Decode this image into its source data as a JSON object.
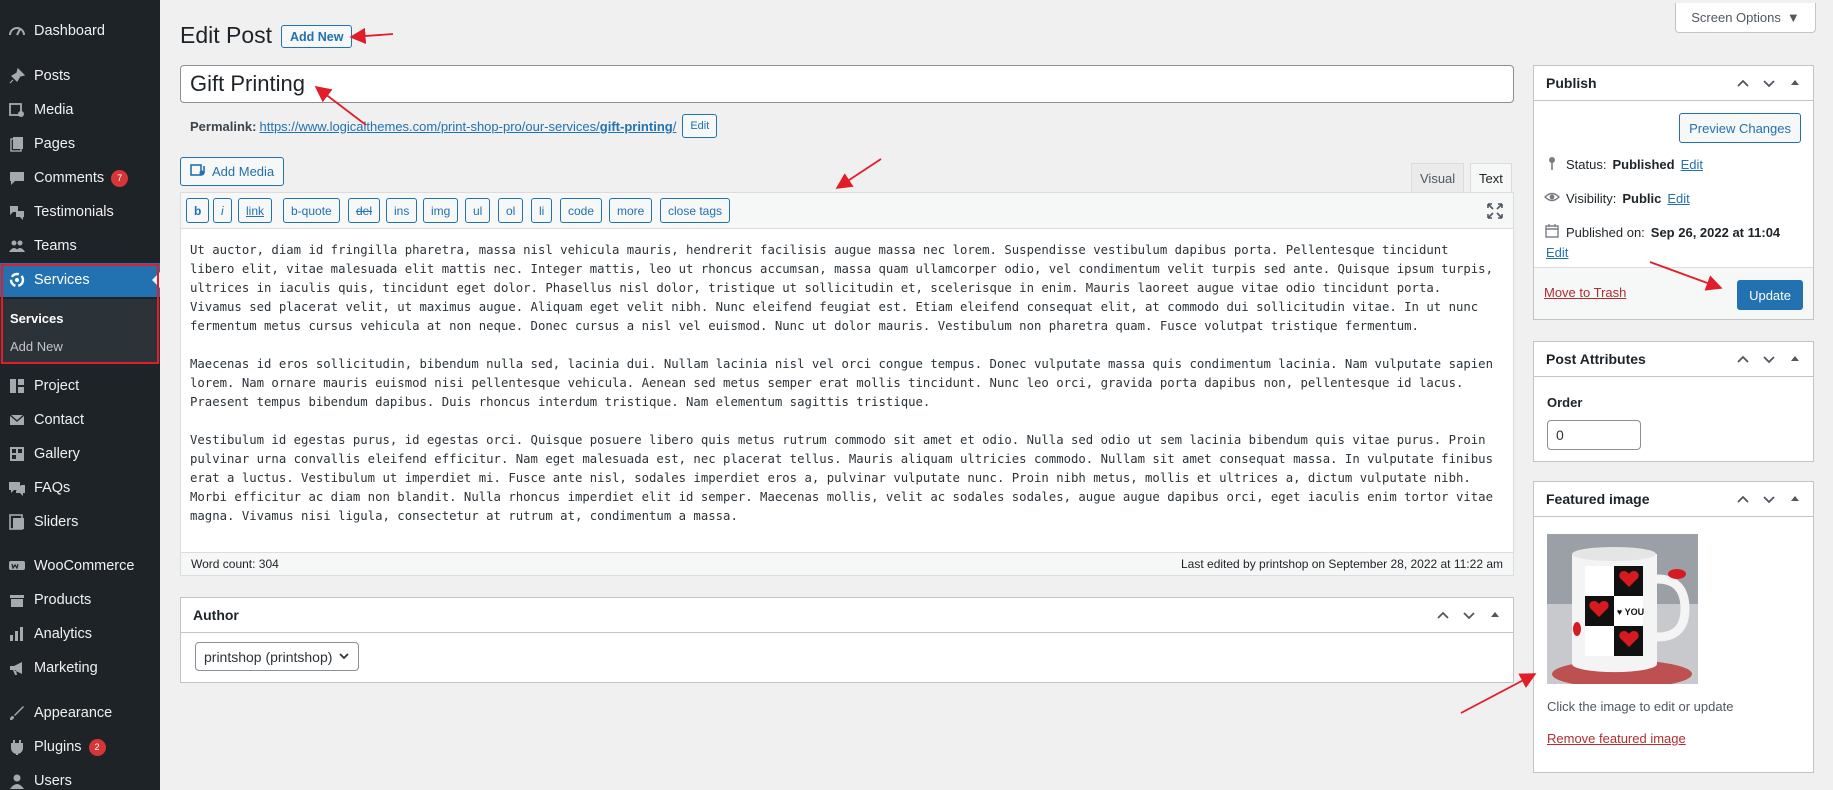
{
  "colors": {
    "sidebar_bg": "#1d2327",
    "accent": "#2271b1",
    "danger": "#b32d2e",
    "badge": "#d63638",
    "annotation": "#e11d2a"
  },
  "sidebar": {
    "items": [
      {
        "label": "Dashboard",
        "icon": "dashboard-icon"
      },
      {
        "label": "Posts",
        "icon": "pushpin-icon"
      },
      {
        "label": "Media",
        "icon": "media-icon"
      },
      {
        "label": "Pages",
        "icon": "pages-icon"
      },
      {
        "label": "Comments",
        "icon": "comments-icon",
        "badge": "7"
      },
      {
        "label": "Testimonials",
        "icon": "testimonials-icon"
      },
      {
        "label": "Teams",
        "icon": "teams-icon"
      },
      {
        "label": "Services",
        "icon": "services-icon"
      },
      {
        "label": "Project",
        "icon": "project-icon"
      },
      {
        "label": "Contact",
        "icon": "mail-icon"
      },
      {
        "label": "Gallery",
        "icon": "gallery-icon"
      },
      {
        "label": "FAQs",
        "icon": "faq-icon"
      },
      {
        "label": "Sliders",
        "icon": "sliders-icon"
      },
      {
        "label": "WooCommerce",
        "icon": "woocommerce-icon"
      },
      {
        "label": "Products",
        "icon": "products-icon"
      },
      {
        "label": "Analytics",
        "icon": "analytics-icon"
      },
      {
        "label": "Marketing",
        "icon": "marketing-icon"
      },
      {
        "label": "Appearance",
        "icon": "appearance-icon"
      },
      {
        "label": "Plugins",
        "icon": "plugins-icon",
        "badge": "2"
      },
      {
        "label": "Users",
        "icon": "users-icon"
      }
    ],
    "submenu": {
      "services": "Services",
      "add_new": "Add New"
    }
  },
  "header": {
    "screen_options": "Screen Options",
    "title": "Edit Post",
    "add_new": "Add New"
  },
  "post": {
    "title": "Gift Printing",
    "permalink_label": "Permalink:",
    "permalink_base": "https://www.logicalthemes.com/print-shop-pro/our-services/",
    "permalink_slug": "gift-printing",
    "permalink_trailing": "/",
    "permalink_edit": "Edit"
  },
  "editor": {
    "add_media": "Add Media",
    "tab_visual": "Visual",
    "tab_text": "Text",
    "quicktags": [
      "b",
      "i",
      "link",
      "b-quote",
      "del",
      "ins",
      "img",
      "ul",
      "ol",
      "li",
      "code",
      "more",
      "close tags"
    ],
    "paragraphs": [
      "Ut auctor, diam id fringilla pharetra, massa nisl vehicula mauris, hendrerit facilisis augue massa nec lorem. Suspendisse vestibulum dapibus porta. Pellentesque tincidunt libero elit, vitae malesuada elit mattis nec. Integer mattis, leo ut rhoncus accumsan, massa quam ullamcorper odio, vel condimentum velit turpis sed ante. Quisque ipsum turpis, ultrices in iaculis quis, tincidunt eget dolor. Phasellus nisl dolor, tristique ut sollicitudin et, scelerisque in enim. Mauris laoreet augue vitae odio tincidunt porta. Vivamus sed placerat velit, ut maximus augue. Aliquam eget velit nibh. Nunc eleifend feugiat est. Etiam eleifend consequat elit, at commodo dui sollicitudin vitae. In ut nunc fermentum metus cursus vehicula at non neque. Donec cursus a nisl vel euismod. Nunc ut dolor mauris. Vestibulum non pharetra quam. Fusce volutpat tristique fermentum.",
      "Maecenas id eros sollicitudin, bibendum nulla sed, lacinia dui. Nullam lacinia nisl vel orci congue tempus. Donec vulputate massa quis condimentum lacinia. Nam vulputate sapien lorem. Nam ornare mauris euismod nisi pellentesque vehicula. Aenean sed metus semper erat mollis tincidunt. Nunc leo orci, gravida porta dapibus non, pellentesque id lacus. Praesent tempus bibendum dapibus. Duis rhoncus interdum tristique. Nam elementum sagittis tristique.",
      "Vestibulum id egestas purus, id egestas orci. Quisque posuere libero quis metus rutrum commodo sit amet et odio. Nulla sed odio ut sem lacinia bibendum quis vitae purus. Proin pulvinar urna convallis eleifend efficitur. Nam eget malesuada est, nec placerat tellus. Mauris aliquam ultricies commodo. Nullam sit amet consequat massa. In vulputate finibus erat a luctus. Vestibulum ut imperdiet mi. Fusce ante nisl, sodales imperdiet eros a, pulvinar vulputate nunc. Proin nibh metus, mollis et ultrices a, dictum vulputate nibh. Morbi efficitur ac diam non blandit. Nulla rhoncus imperdiet elit id semper. Maecenas mollis, velit ac sodales sodales, augue augue dapibus orci, eget iaculis enim tortor vitae magna. Vivamus nisi ligula, consectetur at rutrum at, condimentum a massa."
    ],
    "word_count": "Word count: 304",
    "last_edited": "Last edited by printshop on September 28, 2022 at 11:22 am"
  },
  "author": {
    "title": "Author",
    "selected": "printshop (printshop)"
  },
  "publish": {
    "title": "Publish",
    "preview": "Preview Changes",
    "status_label": "Status:",
    "status_value": "Published",
    "visibility_label": "Visibility:",
    "visibility_value": "Public",
    "published_label": "Published on:",
    "published_value": "Sep 26, 2022 at 11:04",
    "edit": "Edit",
    "trash": "Move to Trash",
    "update": "Update"
  },
  "attributes": {
    "title": "Post Attributes",
    "order_label": "Order",
    "order_value": "0"
  },
  "featured": {
    "title": "Featured image",
    "hint": "Click the image to edit or update",
    "remove": "Remove featured image",
    "mug_text": "I ♥ YOU"
  }
}
